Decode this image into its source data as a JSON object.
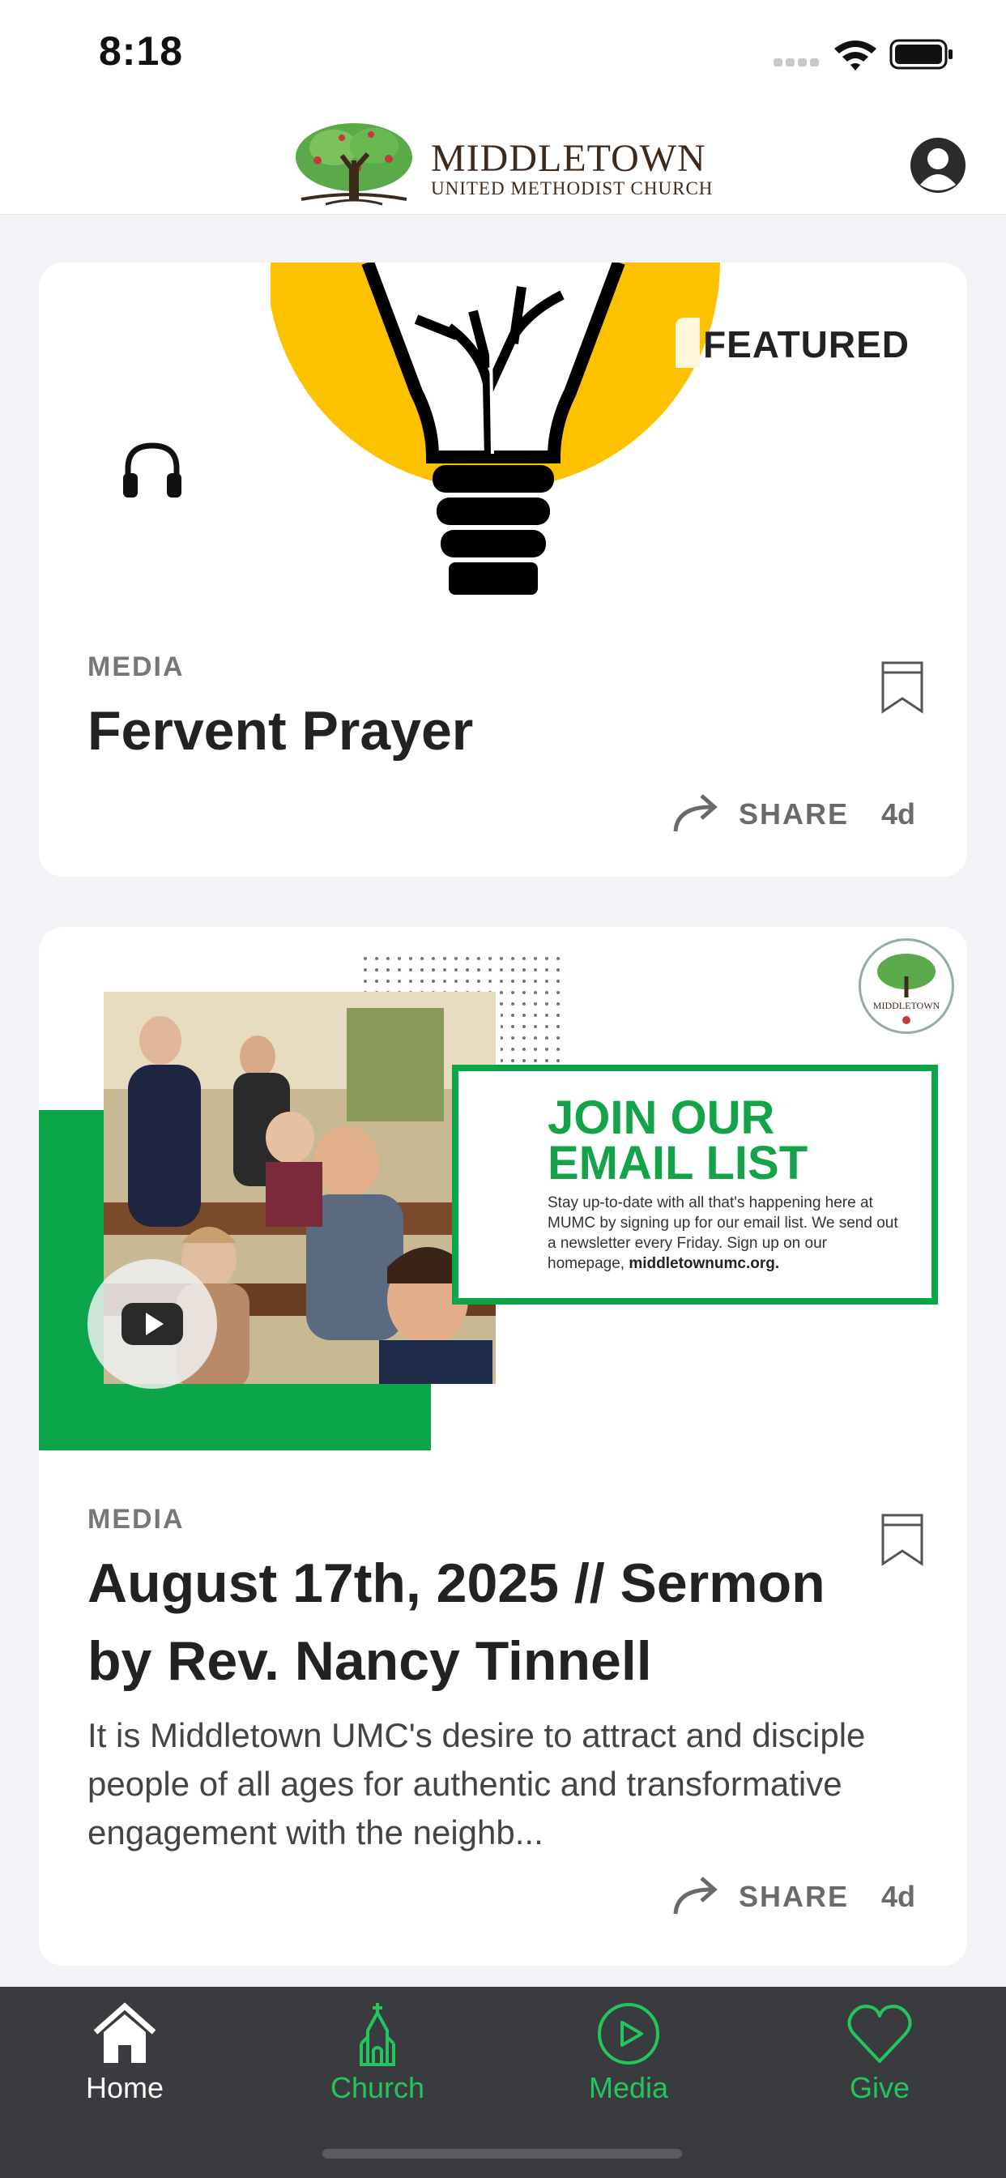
{
  "status_bar": {
    "time": "8:18"
  },
  "header": {
    "logo_name": "MIDDLETOWN",
    "logo_subtitle": "UNITED METHODIST CHURCH",
    "profile_icon": "person-circle-icon"
  },
  "feed": [
    {
      "badge": "FEATURED",
      "media_icon": "headphones-icon",
      "category": "MEDIA",
      "title": "Fervent Prayer",
      "share_label": "SHARE",
      "age": "4d"
    },
    {
      "category": "MEDIA",
      "title": "August 17th, 2025 // Sermon by Rev. Nancy Tinnell",
      "description": "It is Middletown UMC's desire to attract and disciple people of all ages for authentic and transformative engagement with the neighb...",
      "share_label": "SHARE",
      "age": "4d",
      "media_icon": "youtube-play-icon",
      "promo": {
        "headline": "JOIN OUR EMAIL LIST",
        "body": "Stay up-to-date with all that's happening here at MUMC by signing up for our email list. We send out a newsletter every Friday. Sign up on our homepage,",
        "link": "middletownumc.org.",
        "seal_text": "MIDDLETOWN"
      }
    }
  ],
  "tabbar": {
    "tabs": [
      {
        "label": "Home",
        "icon": "house-icon",
        "active": true
      },
      {
        "label": "Church",
        "icon": "church-icon",
        "active": false
      },
      {
        "label": "Media",
        "icon": "play-circle-icon",
        "active": false
      },
      {
        "label": "Give",
        "icon": "heart-icon",
        "active": false
      }
    ]
  },
  "colors": {
    "accent_green": "#22c55e",
    "promo_green": "#0ca64a",
    "bulb_yellow": "#fcc200",
    "tabbar_bg": "#3a3b3e"
  }
}
